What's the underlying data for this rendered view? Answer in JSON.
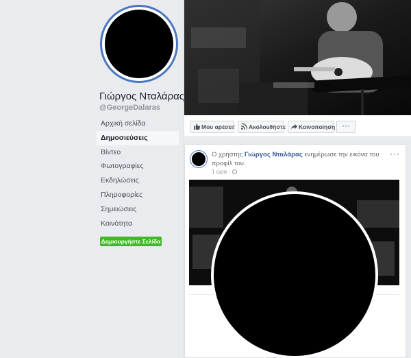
{
  "profile": {
    "name": "Γιώργος Νταλάρας",
    "handle": "@GeorgeDalaras"
  },
  "nav": {
    "items": [
      {
        "label": "Αρχική σελίδα"
      },
      {
        "label": "Δημοσιεύσεις"
      },
      {
        "label": "Βίντεο"
      },
      {
        "label": "Φωτογραφίες"
      },
      {
        "label": "Εκδηλώσεις"
      },
      {
        "label": "Πληροφορίες"
      },
      {
        "label": "Σημειώσεις"
      },
      {
        "label": "Κοινότητα"
      }
    ],
    "create_page": "Δημιουργήστε Σελίδα"
  },
  "actions": {
    "like": "Μου αρέσει!",
    "follow": "Ακολουθήστε",
    "share": "Κοινοποίηση",
    "more": "···"
  },
  "post": {
    "prefix": "Ο χρήστης ",
    "author": "Γιώργος Νταλάρας",
    "suffix": " ενημέρωσε την εικόνα του προφίλ του.",
    "time": "1 ώρα ·",
    "menu": "···"
  },
  "colors": {
    "accent": "#4a76c1",
    "link": "#365899",
    "create_button": "#42b72a",
    "background": "#e9ebee"
  },
  "icons": {
    "like": "thumbs-up-icon",
    "follow": "rss-icon",
    "share": "share-arrow-icon",
    "globe": "globe-icon"
  }
}
